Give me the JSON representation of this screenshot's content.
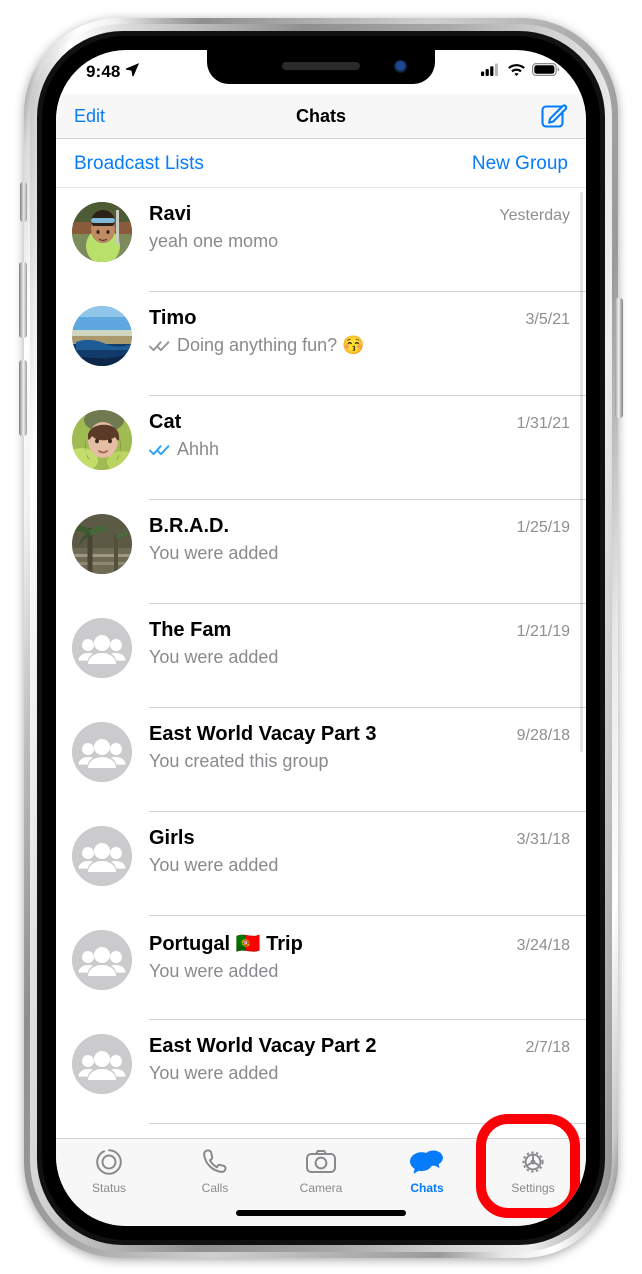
{
  "status_bar": {
    "time": "9:48",
    "location_icon": "location-arrow-icon",
    "cellular_icon": "cellular-signal-icon",
    "wifi_icon": "wifi-icon",
    "battery_icon": "battery-icon"
  },
  "nav": {
    "edit_label": "Edit",
    "title": "Chats",
    "compose_icon": "compose-icon"
  },
  "subheader": {
    "broadcast_label": "Broadcast Lists",
    "new_group_label": "New Group"
  },
  "chats": [
    {
      "name": "Ravi",
      "message": "yeah one momo",
      "time": "Yesterday",
      "avatar": "photo-man-sunglasses",
      "ticks": "none"
    },
    {
      "name": "Timo",
      "message": "Doing anything fun? 😚",
      "time": "3/5/21",
      "avatar": "photo-lake-landscape",
      "ticks": "delivered"
    },
    {
      "name": "Cat",
      "message": "Ahhh",
      "time": "1/31/21",
      "avatar": "photo-woman-leaves",
      "ticks": "read"
    },
    {
      "name": "B.R.A.D.",
      "message": "You were added",
      "time": "1/25/19",
      "avatar": "photo-palm-building",
      "ticks": "none"
    },
    {
      "name": "The Fam",
      "message": "You were added",
      "time": "1/21/19",
      "avatar": "group-icon",
      "ticks": "none"
    },
    {
      "name": "East World Vacay Part 3",
      "message": "You created this group",
      "time": "9/28/18",
      "avatar": "group-icon",
      "ticks": "none"
    },
    {
      "name": "Girls",
      "message": "You were added",
      "time": "3/31/18",
      "avatar": "group-icon",
      "ticks": "none"
    },
    {
      "name": "Portugal 🇵🇹 Trip",
      "message": "You were added",
      "time": "3/24/18",
      "avatar": "group-icon",
      "ticks": "none"
    },
    {
      "name": "East World Vacay Part 2",
      "message": "You were added",
      "time": "2/7/18",
      "avatar": "group-icon",
      "ticks": "none"
    }
  ],
  "tabs": [
    {
      "label": "Status",
      "icon": "status-rings-icon",
      "active": false
    },
    {
      "label": "Calls",
      "icon": "phone-icon",
      "active": false
    },
    {
      "label": "Camera",
      "icon": "camera-icon",
      "active": false
    },
    {
      "label": "Chats",
      "icon": "chat-bubbles-icon",
      "active": true
    },
    {
      "label": "Settings",
      "icon": "gear-icon",
      "active": false
    }
  ],
  "annotation": {
    "highlight_target": "Settings",
    "highlight_color": "#fb0007",
    "shape": "rounded-rectangle-outline"
  },
  "colors": {
    "accent_blue": "#067cfb",
    "read_tick_blue": "#34a3f5",
    "secondary_text": "#8a8a8e",
    "bar_background": "#f7f7f7",
    "separator": "#cfcfd1"
  }
}
